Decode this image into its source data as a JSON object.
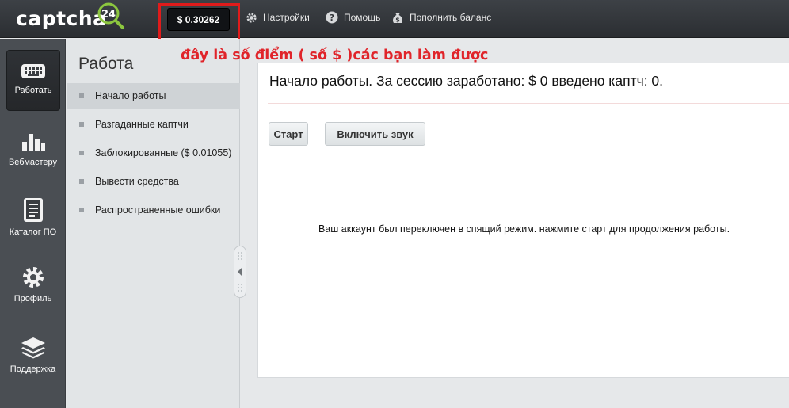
{
  "header": {
    "logo_text": "captcha",
    "logo_badge": "24",
    "balance": "$ 0.30262",
    "nav": [
      {
        "label": "Настройки",
        "icon": "gear-icon"
      },
      {
        "label": "Помощь",
        "icon": "help-icon"
      },
      {
        "label": "Пополнить баланс",
        "icon": "money-bag-icon"
      }
    ]
  },
  "annotation": {
    "text": "đây là số điểm ( số $ )các bạn làm được",
    "color": "#e0242a"
  },
  "rail": {
    "items": [
      {
        "label": "Работать",
        "icon": "keyboard-icon",
        "active": true
      },
      {
        "label": "Вебмастеру",
        "icon": "bar-chart-icon"
      },
      {
        "label": "Каталог ПО",
        "icon": "document-icon"
      },
      {
        "label": "Профиль",
        "icon": "gear-icon"
      },
      {
        "label": "Поддержка",
        "icon": "layers-icon"
      }
    ]
  },
  "sidebar": {
    "title": "Работа",
    "items": [
      {
        "label": "Начало работы",
        "active": true
      },
      {
        "label": "Разгаданные каптчи"
      },
      {
        "label": "Заблокированные ($ 0.01055)"
      },
      {
        "label": "Вывести средства"
      },
      {
        "label": "Распространенные ошибки"
      }
    ]
  },
  "main": {
    "title": "Начало работы. За сессию заработано: $ 0 введено каптч: 0.",
    "start_button": "Старт",
    "sound_button": "Включить звук",
    "message": "Ваш аккаунт был переключен в спящий режим. нажмите старт для продолжения работы."
  }
}
